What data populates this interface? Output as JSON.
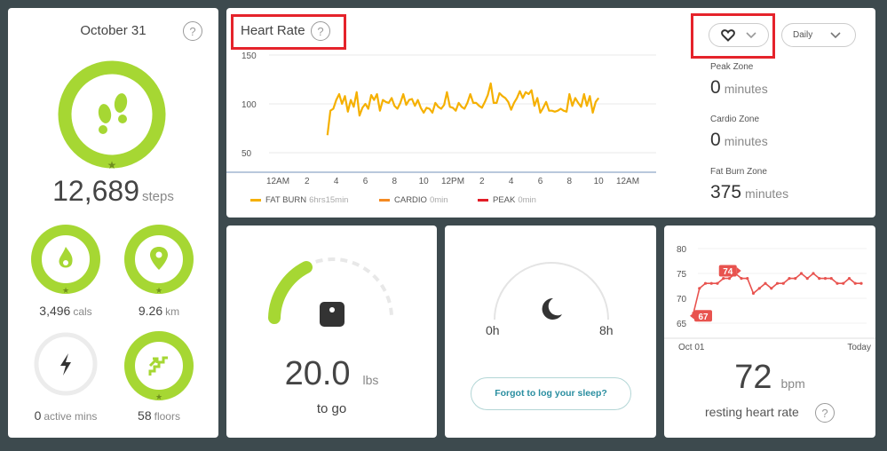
{
  "summary": {
    "date": "October 31",
    "help": "?",
    "steps": {
      "value": "12,689",
      "unit": "steps"
    },
    "calories": {
      "value": "3,496",
      "unit": "cals"
    },
    "distance": {
      "value": "9.26",
      "unit": "km"
    },
    "active": {
      "value": "0",
      "unit": "active mins"
    },
    "floors": {
      "value": "58",
      "unit": "floors"
    }
  },
  "heart_rate": {
    "title": "Heart Rate",
    "help": "?",
    "period_select": "Daily",
    "legend": [
      {
        "label": "FAT BURN",
        "sub": "6hrs15min",
        "color": "#f5b000"
      },
      {
        "label": "CARDIO",
        "sub": "0min",
        "color": "#f48a23"
      },
      {
        "label": "PEAK",
        "sub": "0min",
        "color": "#e21d27"
      }
    ],
    "zones": [
      {
        "label": "Peak Zone",
        "value": "0",
        "unit": "minutes"
      },
      {
        "label": "Cardio Zone",
        "value": "0",
        "unit": "minutes"
      },
      {
        "label": "Fat Burn Zone",
        "value": "375",
        "unit": "minutes"
      }
    ]
  },
  "weight": {
    "value": "20.0",
    "unit": "lbs",
    "caption": "to go"
  },
  "sleep": {
    "start": "0h",
    "end": "8h",
    "button": "Forgot to log your sleep?"
  },
  "resting": {
    "value": "72",
    "unit": "bpm",
    "caption": "resting heart rate",
    "help": "?",
    "badge_start": "67",
    "badge_peak": "74"
  },
  "chart_data": [
    {
      "type": "line",
      "ylim": [
        30,
        150
      ],
      "yticks": [
        "150",
        "100",
        "50"
      ],
      "xticks": [
        "12AM",
        "2",
        "4",
        "6",
        "8",
        "10",
        "12PM",
        "2",
        "4",
        "6",
        "8",
        "10",
        "12AM"
      ],
      "series": [
        {
          "name": "FAT BURN",
          "color": "#f5b000",
          "x": [
            3.4,
            3.6,
            3.8,
            4.0,
            4.2,
            4.4,
            4.6,
            4.8,
            5.0,
            5.2,
            5.4,
            5.6,
            5.8,
            6.0,
            6.2,
            6.4,
            6.6,
            6.8,
            7.0,
            7.2,
            7.4,
            7.6,
            7.8,
            8.0,
            8.2,
            8.4,
            8.6,
            8.8,
            9.0,
            9.2,
            9.4,
            9.6,
            9.8,
            10.0,
            10.2,
            10.4,
            10.6,
            10.8,
            11.0,
            11.2,
            11.4,
            11.6,
            11.8,
            12.0,
            12.2,
            12.4,
            12.6,
            12.8,
            13.0,
            13.2,
            13.4,
            13.6,
            13.8,
            14.0,
            14.2,
            14.4,
            14.6,
            14.8,
            15.0,
            15.2,
            15.4,
            15.6,
            15.8,
            16.0,
            16.2,
            16.4,
            16.6,
            16.8,
            17.0,
            17.2,
            17.4,
            17.6,
            17.8,
            18.0,
            18.2,
            18.4,
            18.6,
            18.8,
            19.0,
            19.2,
            19.4,
            19.6,
            19.8,
            20.0,
            20.2,
            20.4,
            20.6,
            20.8,
            21.0,
            21.2,
            21.4,
            21.6,
            21.8,
            22.0
          ],
          "values": [
            68,
            93,
            95,
            104,
            110,
            100,
            108,
            92,
            104,
            97,
            112,
            88,
            96,
            100,
            95,
            109,
            104,
            110,
            93,
            104,
            102,
            101,
            106,
            98,
            95,
            101,
            110,
            99,
            104,
            105,
            98,
            104,
            96,
            91,
            96,
            95,
            91,
            101,
            97,
            95,
            99,
            112,
            97,
            96,
            93,
            101,
            97,
            95,
            101,
            110,
            101,
            101,
            98,
            96,
            102,
            109,
            121,
            101,
            101,
            111,
            108,
            106,
            102,
            94,
            101,
            106,
            113,
            106,
            112,
            110,
            114,
            98,
            106,
            91,
            96,
            102,
            93,
            93,
            92,
            93,
            95,
            93,
            92,
            110,
            98,
            106,
            101,
            97,
            110,
            98,
            108,
            91,
            102,
            106
          ]
        }
      ]
    },
    {
      "type": "line",
      "ylim": [
        65,
        80
      ],
      "yticks": [
        "80",
        "75",
        "70",
        "65"
      ],
      "xticks": [
        "Oct 01",
        "Today"
      ],
      "series": [
        {
          "name": "",
          "color": "#e8534f",
          "values": [
            67,
            72,
            73,
            73,
            73,
            74,
            74,
            75,
            74,
            74,
            71,
            72,
            73,
            72,
            73,
            73,
            74,
            74,
            75,
            74,
            75,
            74,
            74,
            74,
            73,
            73,
            74,
            73,
            73
          ]
        }
      ]
    }
  ]
}
